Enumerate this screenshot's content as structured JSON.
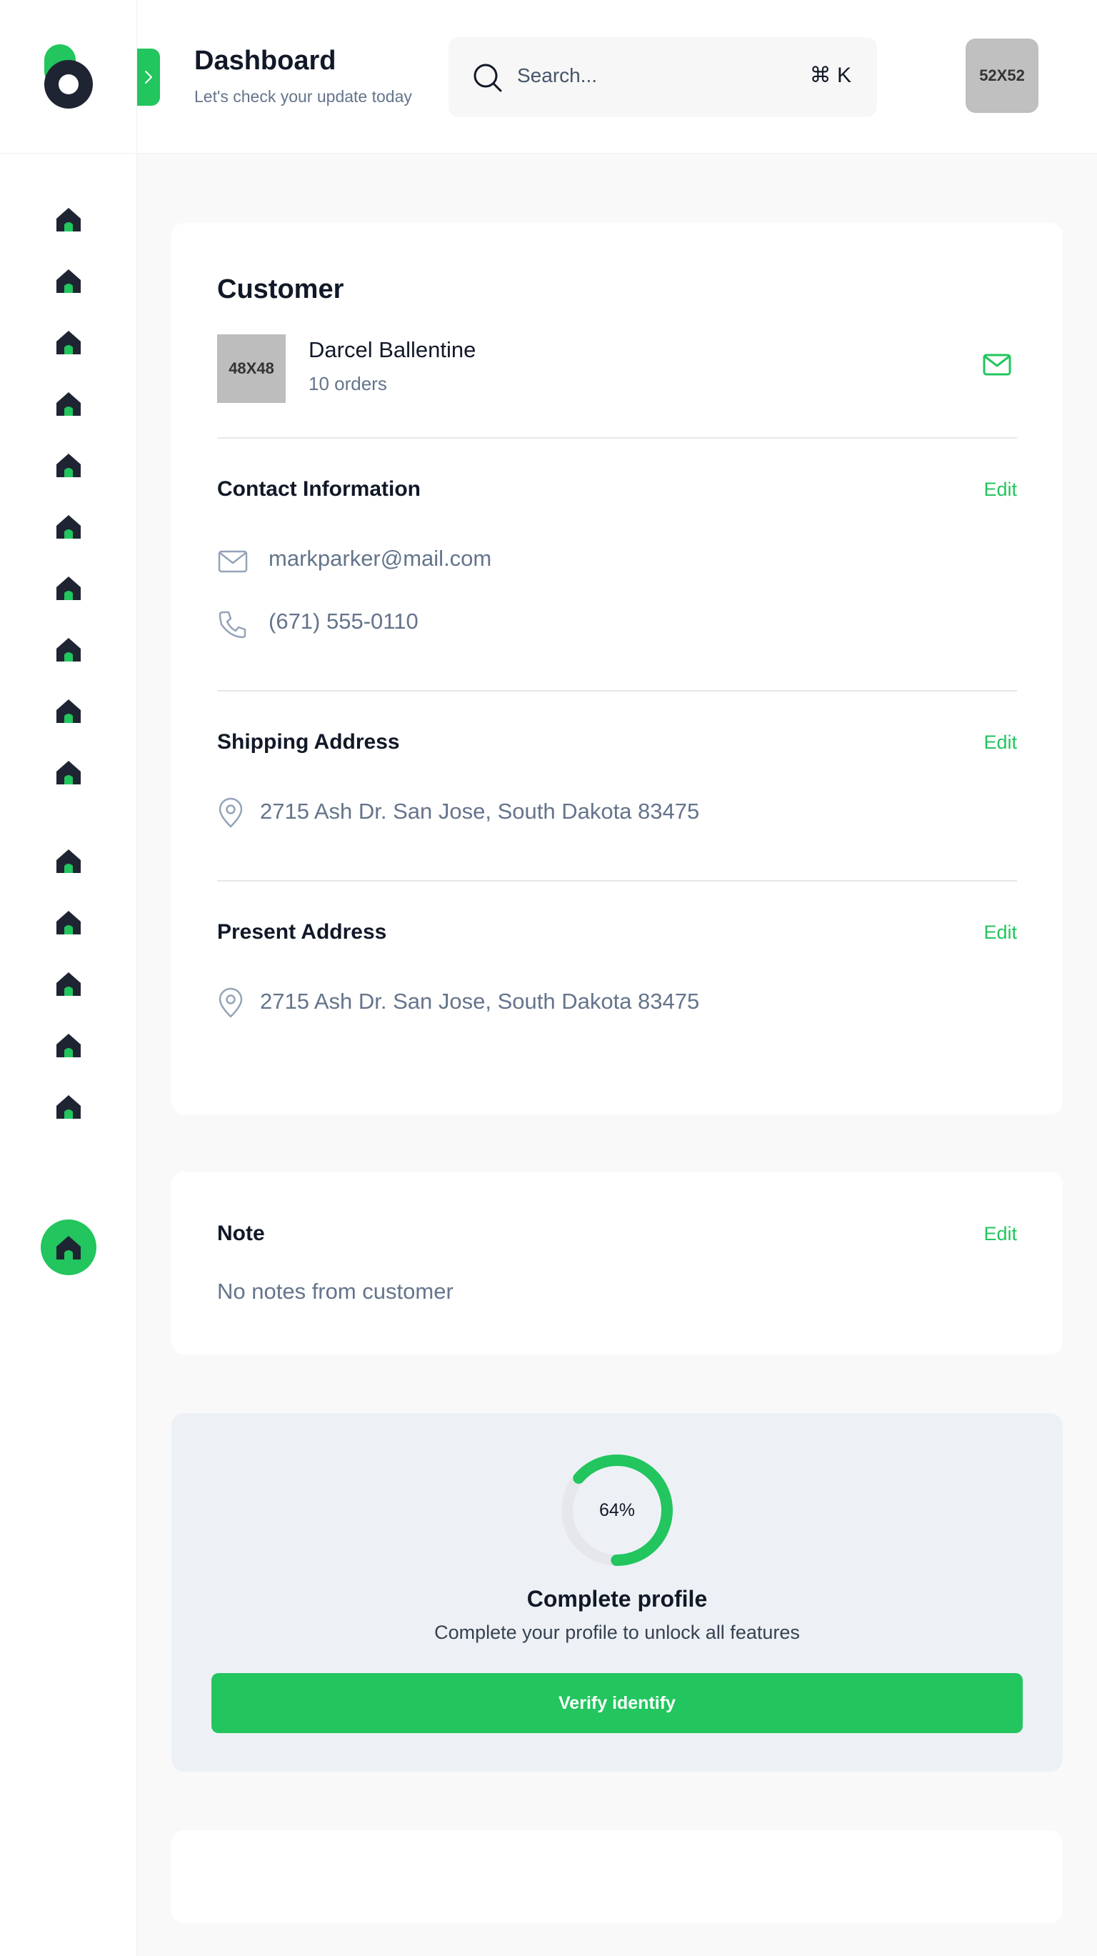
{
  "header": {
    "title": "Dashboard",
    "subtitle": "Let's check your update today",
    "search_placeholder": "Search...",
    "search_shortcut": "⌘ K",
    "avatar_label": "52X52"
  },
  "sidebar": {
    "nav_icons": [
      "home-icon",
      "home-icon",
      "home-icon",
      "home-icon",
      "home-icon",
      "home-icon",
      "home-icon",
      "home-icon",
      "home-icon",
      "home-icon",
      "home-icon",
      "home-icon",
      "home-icon",
      "home-icon",
      "home-icon"
    ],
    "active_icon": "home-icon"
  },
  "customer": {
    "heading": "Customer",
    "avatar_label": "48X48",
    "name": "Darcel Ballentine",
    "orders": "10 orders",
    "contact": {
      "title": "Contact Information",
      "edit": "Edit",
      "email": "markparker@mail.com",
      "phone": "(671) 555-0110"
    },
    "shipping": {
      "title": "Shipping Address",
      "edit": "Edit",
      "address": "2715 Ash Dr. San Jose, South Dakota 83475"
    },
    "present": {
      "title": "Present Address",
      "edit": "Edit",
      "address": "2715 Ash Dr. San Jose, South Dakota 83475"
    }
  },
  "note": {
    "title": "Note",
    "edit": "Edit",
    "text": "No notes from customer"
  },
  "profile": {
    "percent_label": "64%",
    "percent_value": 64,
    "title": "Complete profile",
    "subtitle": "Complete your profile to unlock all features",
    "button": "Verify identify"
  },
  "colors": {
    "accent": "#22c55e",
    "dark": "#1f2433",
    "muted": "#64748b"
  }
}
